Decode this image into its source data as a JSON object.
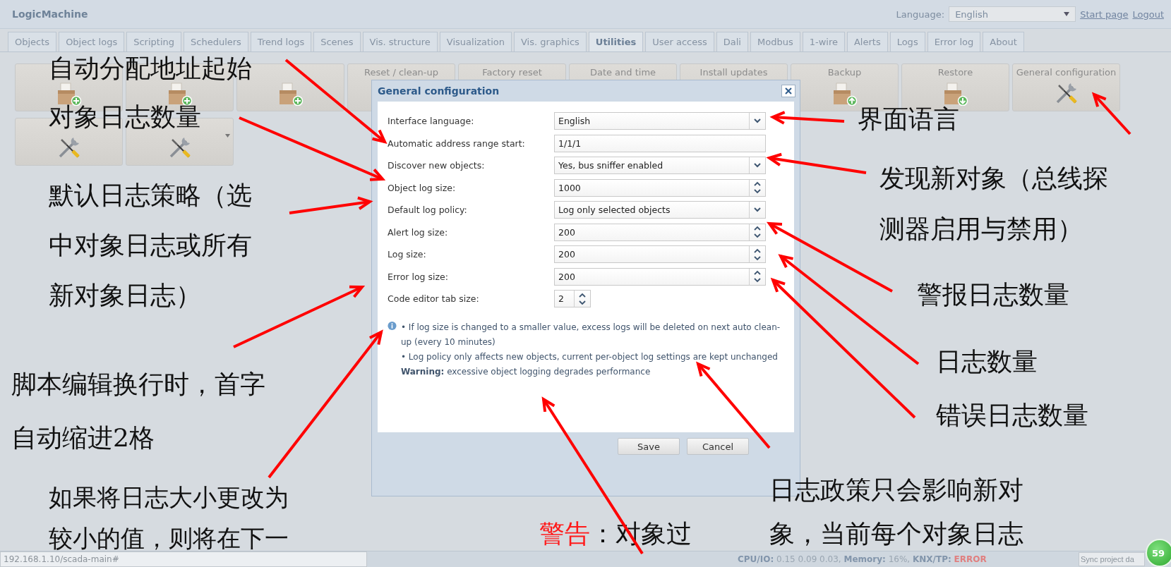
{
  "header": {
    "title": "LogicMachine",
    "language_label": "Language:",
    "language_value": "English",
    "links": [
      "Start page",
      "Logout"
    ]
  },
  "tabs": [
    {
      "label": "Objects",
      "selected": false
    },
    {
      "label": "Object logs",
      "selected": false
    },
    {
      "label": "Scripting",
      "selected": false
    },
    {
      "label": "Schedulers",
      "selected": false
    },
    {
      "label": "Trend logs",
      "selected": false
    },
    {
      "label": "Scenes",
      "selected": false
    },
    {
      "label": "Vis. structure",
      "selected": false
    },
    {
      "label": "Visualization",
      "selected": false
    },
    {
      "label": "Vis. graphics",
      "selected": false
    },
    {
      "label": "Utilities",
      "selected": true
    },
    {
      "label": "User access",
      "selected": false
    },
    {
      "label": "Dali",
      "selected": false
    },
    {
      "label": "Modbus",
      "selected": false
    },
    {
      "label": "1-wire",
      "selected": false
    },
    {
      "label": "Alerts",
      "selected": false
    },
    {
      "label": "Logs",
      "selected": false
    },
    {
      "label": "Error log",
      "selected": false
    },
    {
      "label": "About",
      "selected": false
    }
  ],
  "tiles": [
    {
      "kind": "import"
    },
    {
      "kind": "import"
    },
    {
      "kind": "import"
    },
    {
      "label": "Reset / clean-up",
      "kind": "plain"
    },
    {
      "label": "Factory reset",
      "kind": "plain"
    },
    {
      "label": "Date and time",
      "kind": "plain"
    },
    {
      "label": "Install updates",
      "kind": "plain"
    },
    {
      "label": "Backup",
      "kind": "backup"
    },
    {
      "label": "Restore",
      "kind": "restore"
    },
    {
      "label": "General configuration",
      "kind": "tools"
    },
    {
      "kind": "tools"
    },
    {
      "kind": "tools",
      "menu": true
    }
  ],
  "dialog": {
    "title": "General configuration",
    "fields": [
      {
        "label": "Interface language:",
        "kind": "select",
        "value": "English"
      },
      {
        "label": "Automatic address range start:",
        "kind": "text",
        "value": "1/1/1"
      },
      {
        "label": "Discover new objects:",
        "kind": "select",
        "value": "Yes, bus sniffer enabled"
      },
      {
        "label": "Object log size:",
        "kind": "spinner",
        "value": "1000"
      },
      {
        "label": "Default log policy:",
        "kind": "select",
        "value": "Log only selected objects"
      },
      {
        "label": "Alert log size:",
        "kind": "spinner",
        "value": "200"
      },
      {
        "label": "Log size:",
        "kind": "spinner",
        "value": "200"
      },
      {
        "label": "Error log size:",
        "kind": "spinner",
        "value": "200"
      },
      {
        "label": "Code editor tab size:",
        "kind": "small-spinner",
        "value": "2"
      }
    ],
    "notes": [
      "• If log size is changed to a smaller value, excess logs will be deleted on next auto clean-up (every 10 minutes)",
      "• Log policy only affects new objects, current per-object log settings are kept unchanged",
      "**Warning:** excessive object logging degrades performance"
    ],
    "buttons": [
      "Save",
      "Cancel"
    ]
  },
  "status_bar": {
    "url": "192.168.1.10/scada-main#",
    "items": [
      {
        "label": "CPU/IO:",
        "value": "0.15 0.09 0.03,",
        "error": false
      },
      {
        "label": "Memory:",
        "value": "16%,",
        "error": false
      },
      {
        "label": "KNX/TP:",
        "value": "ERROR",
        "error": true
      }
    ],
    "sync_placeholder": "Sync project da",
    "badge": "59"
  },
  "annotations": [
    {
      "text": "自动分配地址起始"
    },
    {
      "text": "对象日志数量"
    },
    {
      "text": "界面语言"
    },
    {
      "text": "发现新对象（总线探测器启用与禁用）"
    },
    {
      "text": "默认日志策略（选中对象日志或所有新对象日志）"
    },
    {
      "text": "警报日志数量"
    },
    {
      "text": "日志数量"
    },
    {
      "text": "脚本编辑换行时，首字自动缩进2格"
    },
    {
      "text": "错误日志数量"
    },
    {
      "text": "如果将日志大小更改为较小的值，则将在下一"
    },
    {
      "lead": "警告",
      "text": "：对象过"
    },
    {
      "text": "日志政策只会影响新对象，当前每个对象日志"
    }
  ]
}
